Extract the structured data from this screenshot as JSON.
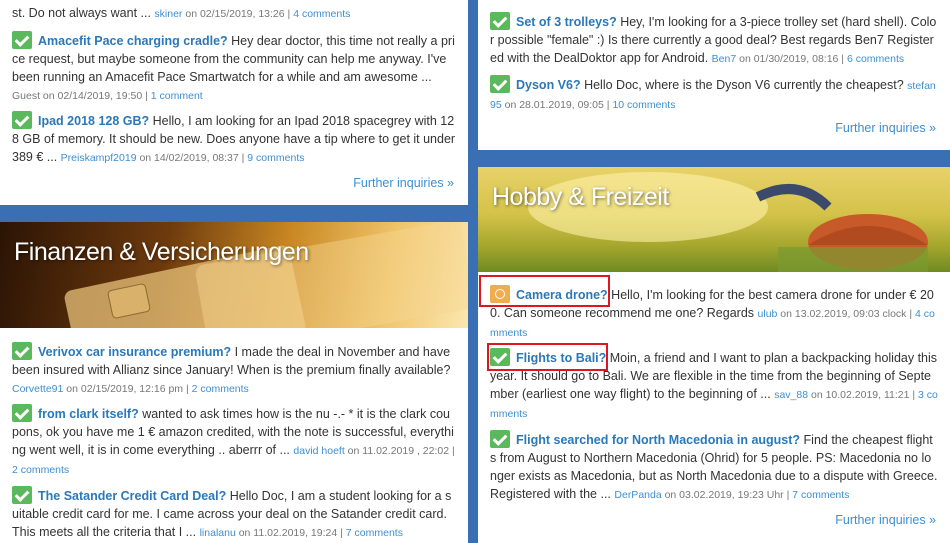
{
  "left_top": {
    "posts": [
      {
        "pre": "st. Do not always want ... ",
        "user": "skiner",
        "date": " on 02/15/2019, 13:26 | ",
        "comments": "4 comments"
      },
      {
        "title": "Amacefit Pace charging cradle?",
        "body": " Hey dear doctor, this time not really a price request, but maybe someone from the community can help me anyway. I've been running an Amacefit Pace Smartwatch for a while and am awesome ...",
        "user": "Guest",
        "date": " on 02/14/2019, 19:50 | ",
        "comments": "1 comment"
      },
      {
        "title": "Ipad 2018 128 GB?",
        "body": " Hello, I am looking for an Ipad 2018 spacegrey with 128 GB of memory. It should be new. Does anyone have a tip where to get it under 389 € ...",
        "user": "Preiskampf2019",
        "date": " on 14/02/2019, 08:37 | ",
        "comments": "9 comments"
      }
    ],
    "further": "Further inquiries »"
  },
  "finance": {
    "banner_title": "Finanzen & Versicherungen",
    "posts": [
      {
        "title": "Verivox car insurance premium?",
        "body": " I made the deal in November and have been insured with Allianz since January! When is the premium finally available?",
        "user": "Corvette91",
        "date": " on 02/15/2019, 12:16 pm | ",
        "comments": "2 comments"
      },
      {
        "title": "from clark itself?",
        "body": " wanted to ask times how is the nu -.- * it is the clark coupons, ok you have me 1 € amazon credited, with the note is successful, everything went well, it is in come everything .. aberrr of ...",
        "user": "david hoeft",
        "date": " on 11.02.2019 , 22:02 | ",
        "comments": "2 comments"
      },
      {
        "title": "The Satander Credit Card Deal?",
        "body": " Hello Doc, I am a student looking for a suitable credit card for me. I came across your deal on the Satander credit card. This meets all the criteria that I ...",
        "user": "linalanu",
        "date": " on 11.02.2019, 19:24 | ",
        "comments": "7 comments"
      }
    ]
  },
  "right_top": {
    "posts": [
      {
        "title": "Set of 3 trolleys?",
        "body": " Hey, I'm looking for a 3-piece trolley set (hard shell). Color possible \"female\" :) Is there currently a good deal? Best regards Ben7 Registered with the DealDoktor app for Android.",
        "user": "Ben7",
        "date": " on 01/30/2019, 08:16 | ",
        "comments": "6 comments"
      },
      {
        "title": "Dyson V6?",
        "body": " Hello Doc, where is the Dyson V6 currently the cheapest?",
        "user": "stefan95",
        "date": " on 28.01.2019, 09:05 | ",
        "comments": "10 comments"
      }
    ],
    "further": "Further inquiries »"
  },
  "hobby": {
    "banner_title": "Hobby & Freizeit",
    "posts": [
      {
        "title": "Camera drone?",
        "body": " Hello, I'm looking for the best camera drone for under € 200. Can someone recommend me one? Regards",
        "user": "ulub",
        "date": " on 13.02.2019, 09:03 clock | ",
        "comments": "4 comments"
      },
      {
        "title": "Flights to Bali?",
        "body": " Moin, a friend and I want to plan a backpacking holiday this year. It should go to Bali. We are flexible in the time from the beginning of September (earliest one way flight) to the beginning of ...",
        "user": "sav_88",
        "date": " on 10.02.2019, 11:21 | ",
        "comments": "3 comments"
      },
      {
        "title": "Flight searched for North Macedonia in august?",
        "body": " Find the cheapest flights from August to Northern Macedonia (Ohrid) for 5 people. PS: Macedonia no longer exists as Macedonia, but as North Macedonia due to a dispute with Greece. Registered with the ...",
        "user": "DerPanda",
        "date": " on 03.02.2019, 19:23 Uhr | ",
        "comments": "7 comments"
      }
    ],
    "further": "Further inquiries »"
  },
  "colors": {
    "background": "#3a6fb3",
    "link": "#2a78b8",
    "check": "#5cb85c",
    "pending": "#f0ad4e",
    "highlight": "#e0161d"
  },
  "icons": {
    "check": "checkmark-icon",
    "pending": "clock-icon"
  }
}
